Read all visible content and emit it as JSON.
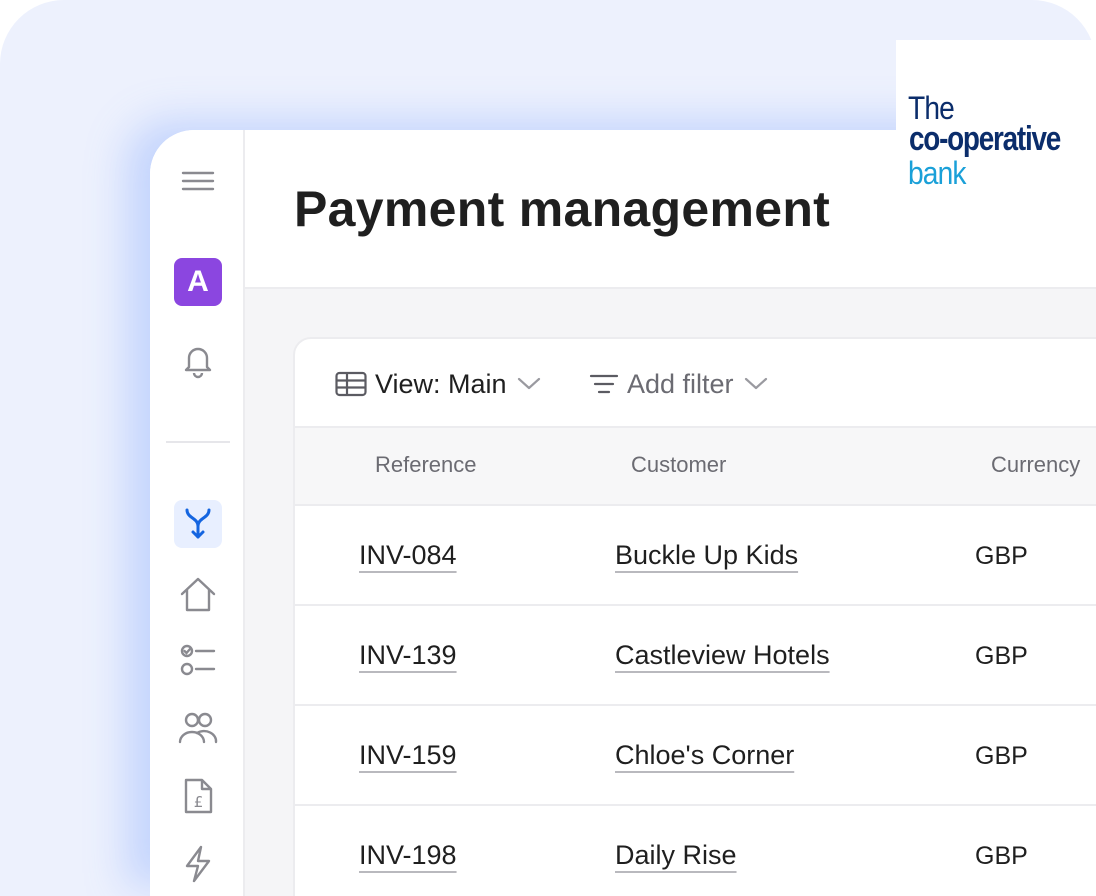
{
  "app": {
    "page_title": "Payment management",
    "avatar_initial": "A",
    "accent_color": "#8b46e0",
    "active_nav_color": "#1565e0"
  },
  "sidebar": {
    "icons": [
      "menu-icon",
      "bell-icon",
      "merge-icon",
      "home-icon",
      "tasks-icon",
      "people-icon",
      "invoice-icon",
      "bolt-icon"
    ]
  },
  "toolbar": {
    "view_label": "View: Main",
    "filter_label": "Add filter"
  },
  "table": {
    "columns": [
      "Reference",
      "Customer",
      "Currency"
    ],
    "rows": [
      {
        "reference": "INV-084",
        "customer": "Buckle Up Kids",
        "currency": "GBP"
      },
      {
        "reference": "INV-139",
        "customer": "Castleview Hotels",
        "currency": "GBP"
      },
      {
        "reference": "INV-159",
        "customer": "Chloe's Corner",
        "currency": "GBP"
      },
      {
        "reference": "INV-198",
        "customer": "Daily Rise",
        "currency": "GBP"
      }
    ]
  },
  "logo": {
    "line1": "The",
    "line2": "co-operative",
    "line3": "bank"
  }
}
